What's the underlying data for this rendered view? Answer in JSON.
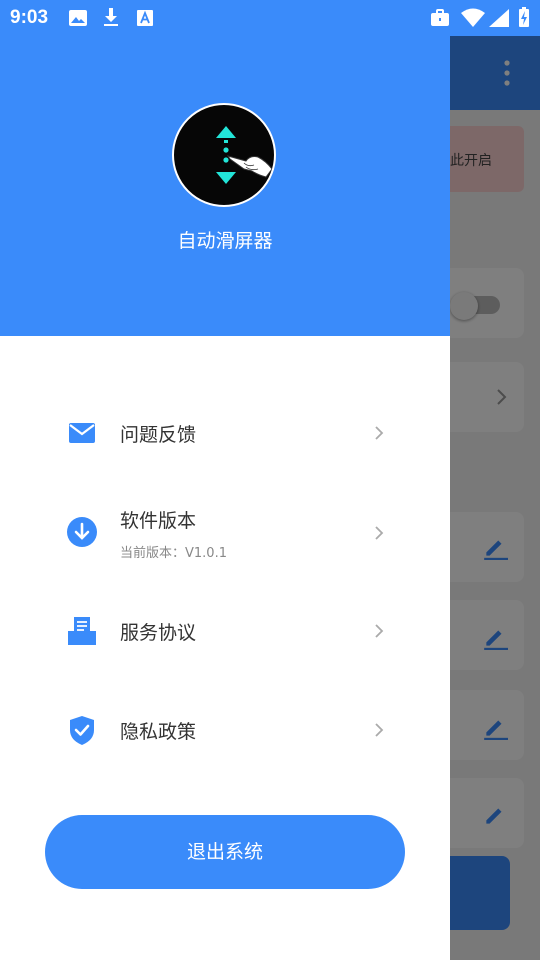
{
  "status_bar": {
    "time": "9:03"
  },
  "background": {
    "notice_text": "此开启"
  },
  "drawer": {
    "app_name": "自动滑屏器",
    "menu": [
      {
        "label": "问题反馈",
        "icon": "mail-icon"
      },
      {
        "label": "软件版本",
        "sub": "当前版本：V1.0.1",
        "icon": "download-circle-icon"
      },
      {
        "label": "服务协议",
        "icon": "document-tray-icon"
      },
      {
        "label": "隐私政策",
        "icon": "shield-check-icon"
      }
    ],
    "logout_label": "退出系统"
  },
  "colors": {
    "primary": "#3a8bfa",
    "logo_accent": "#22e5d8"
  }
}
